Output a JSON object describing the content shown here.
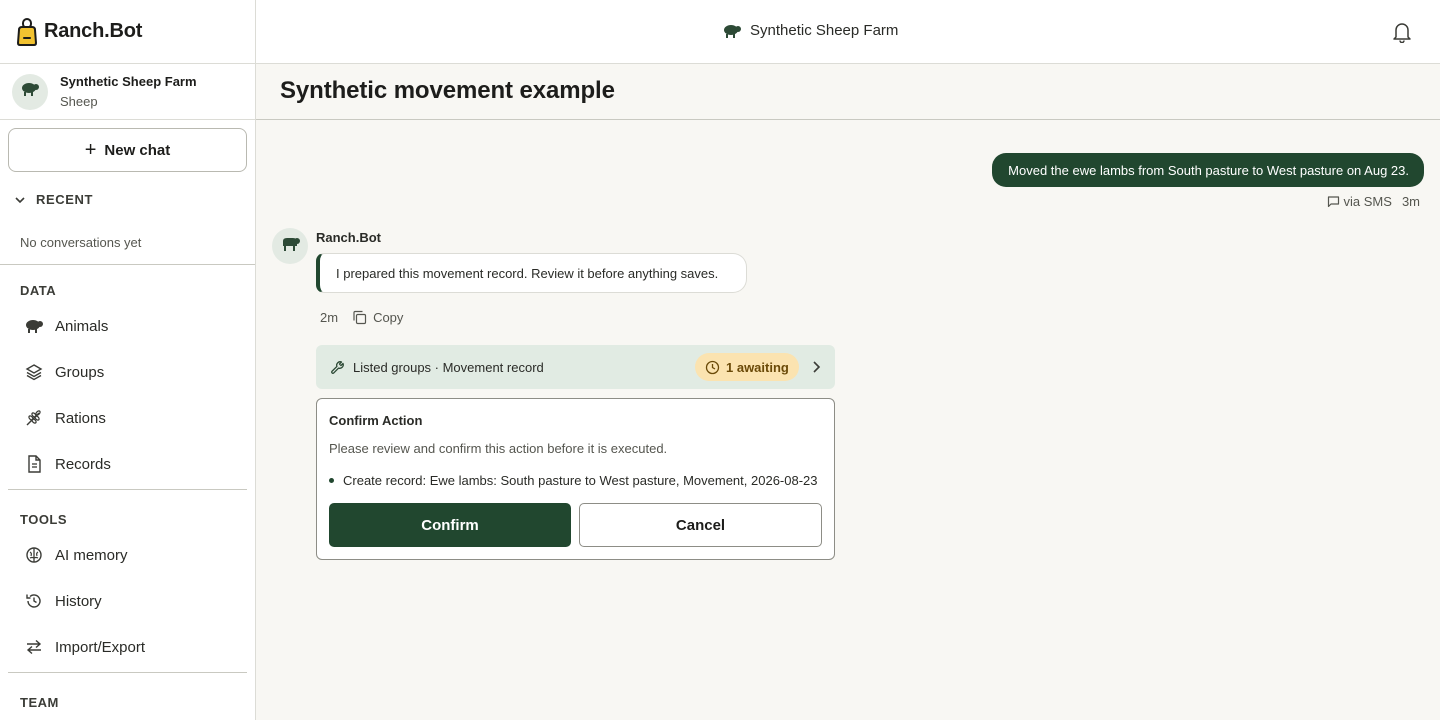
{
  "brand": {
    "name": "Ranch.Bot",
    "icon": "ear-tag-icon",
    "accent": "#21472f"
  },
  "farm": {
    "name": "Synthetic Sheep Farm",
    "type": "Sheep",
    "icon": "sheep-icon"
  },
  "sidebar": {
    "new_chat_label": "New chat",
    "recent_label": "RECENT",
    "no_conversations": "No conversations yet",
    "data_label": "DATA",
    "data_items": [
      {
        "label": "Animals",
        "icon": "sheep-icon"
      },
      {
        "label": "Groups",
        "icon": "layers-icon"
      },
      {
        "label": "Rations",
        "icon": "wheat-icon"
      },
      {
        "label": "Records",
        "icon": "document-icon"
      }
    ],
    "tools_label": "TOOLS",
    "tools_items": [
      {
        "label": "AI memory",
        "icon": "brain-icon"
      },
      {
        "label": "History",
        "icon": "history-icon"
      },
      {
        "label": "Import/Export",
        "icon": "arrows-swap-icon"
      }
    ],
    "team_label": "TEAM"
  },
  "topbar": {
    "farm_name": "Synthetic Sheep Farm",
    "bell_icon": "bell-icon"
  },
  "page": {
    "title": "Synthetic movement example"
  },
  "chat": {
    "user_message": {
      "text": "Moved the ewe lambs from South pasture to West pasture on Aug 23.",
      "channel": "via SMS",
      "time": "3m"
    },
    "bot_message": {
      "author": "Ranch.Bot",
      "text": "I prepared this movement record. Review it before anything saves.",
      "time": "2m",
      "copy_label": "Copy"
    },
    "tool_strip": {
      "label": "Listed groups · Movement record",
      "awaiting": "1 awaiting",
      "awaiting_color": "#fbe3b0"
    },
    "confirm_card": {
      "title": "Confirm Action",
      "description": "Please review and confirm this action before it is executed.",
      "item": "Create record: Ewe lambs: South pasture to West pasture, Movement, 2026-08-23",
      "confirm_label": "Confirm",
      "cancel_label": "Cancel"
    }
  }
}
